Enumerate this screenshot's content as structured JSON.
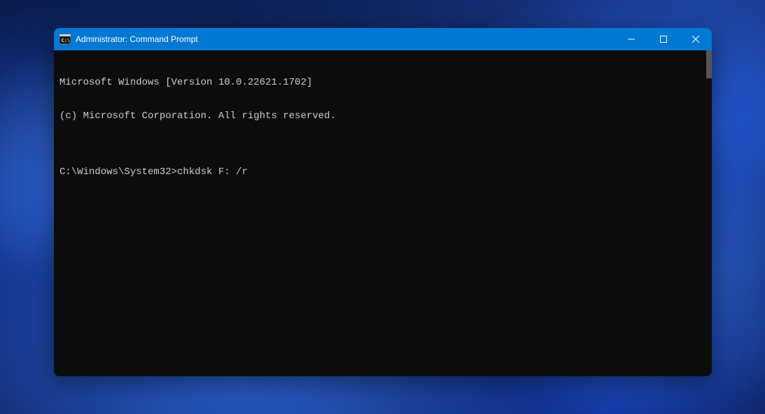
{
  "window": {
    "title": "Administrator: Command Prompt"
  },
  "terminal": {
    "line1": "Microsoft Windows [Version 10.0.22621.1702]",
    "line2": "(c) Microsoft Corporation. All rights reserved.",
    "blank": "",
    "prompt": "C:\\Windows\\System32>",
    "command": "chkdsk F: /r"
  }
}
